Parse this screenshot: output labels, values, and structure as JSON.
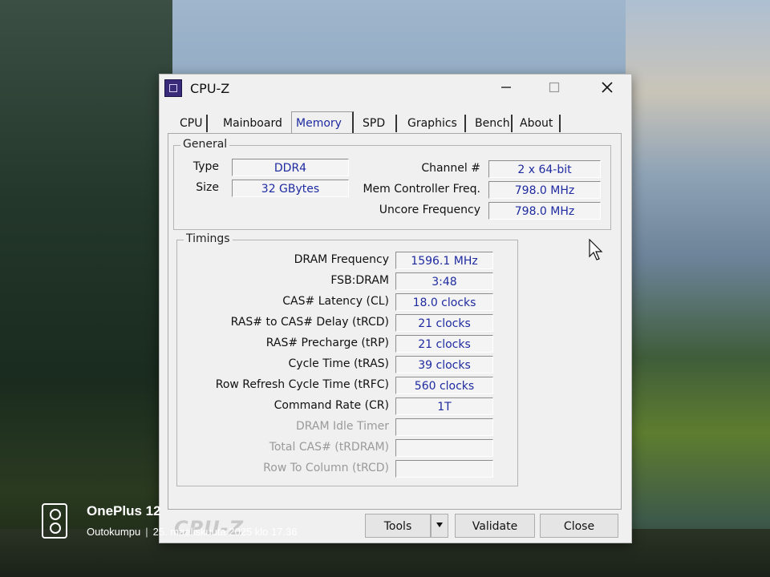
{
  "window": {
    "title": "CPU-Z"
  },
  "tabs": [
    "CPU",
    "Mainboard",
    "Memory",
    "SPD",
    "Graphics",
    "Bench",
    "About"
  ],
  "active_tab": "Memory",
  "general": {
    "title": "General",
    "type_label": "Type",
    "type_value": "DDR4",
    "size_label": "Size",
    "size_value": "32 GBytes",
    "channel_label": "Channel #",
    "channel_value": "2 x 64-bit",
    "mem_ctrl_label": "Mem Controller Freq.",
    "mem_ctrl_value": "798.0 MHz",
    "uncore_label": "Uncore Frequency",
    "uncore_value": "798.0 MHz"
  },
  "timings": {
    "title": "Timings",
    "rows": [
      {
        "label": "DRAM Frequency",
        "value": "1596.1 MHz",
        "enabled": true
      },
      {
        "label": "FSB:DRAM",
        "value": "3:48",
        "enabled": true
      },
      {
        "label": "CAS# Latency (CL)",
        "value": "18.0 clocks",
        "enabled": true
      },
      {
        "label": "RAS# to CAS# Delay (tRCD)",
        "value": "21 clocks",
        "enabled": true
      },
      {
        "label": "RAS# Precharge (tRP)",
        "value": "21 clocks",
        "enabled": true
      },
      {
        "label": "Cycle Time (tRAS)",
        "value": "39 clocks",
        "enabled": true
      },
      {
        "label": "Row Refresh Cycle Time (tRFC)",
        "value": "560 clocks",
        "enabled": true
      },
      {
        "label": "Command Rate (CR)",
        "value": "1T",
        "enabled": true
      },
      {
        "label": "DRAM Idle Timer",
        "value": "",
        "enabled": false
      },
      {
        "label": "Total CAS# (tRDRAM)",
        "value": "",
        "enabled": false
      },
      {
        "label": "Row To Column (tRCD)",
        "value": "",
        "enabled": false
      }
    ]
  },
  "footer": {
    "logo": "CPU-Z",
    "tools_label": "Tools",
    "validate_label": "Validate",
    "close_label": "Close"
  },
  "photo_watermark": {
    "brand": "OnePlus 12",
    "location": "Outokumpu",
    "datetime": "25. maaliskuuta 2025 klo 17.36"
  },
  "colors": {
    "value_text": "#1e2aa0",
    "window_bg": "#f0f0f0",
    "disabled_text": "#9a9a9a"
  }
}
